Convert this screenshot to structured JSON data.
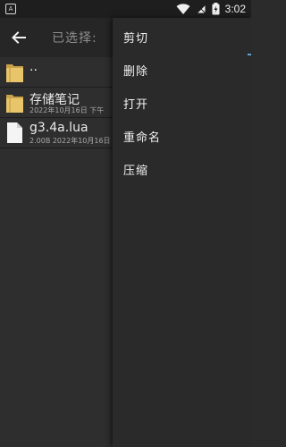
{
  "status_bar": {
    "time": "3:02",
    "left_icon_glyph": "A"
  },
  "header": {
    "title": "已选择:"
  },
  "files": [
    {
      "name": "..",
      "meta": "",
      "icon": "folder-icon"
    },
    {
      "name": "存储笔记",
      "meta": "2022年10月16日 下午",
      "icon": "folder-icon"
    },
    {
      "name": "g3.4a.lua",
      "meta": "2.00B   2022年10月16日",
      "icon": "document-icon"
    }
  ],
  "context_menu": {
    "items": [
      {
        "label": "剪切"
      },
      {
        "label": "删除"
      },
      {
        "label": "打开"
      },
      {
        "label": "重命名"
      },
      {
        "label": "压缩"
      }
    ]
  },
  "colors": {
    "background": "#2e2e2e",
    "app_bar": "#262626",
    "menu_bg": "#2a2a2a",
    "folder": "#e8c46a",
    "accent": "#5fa7d5"
  }
}
